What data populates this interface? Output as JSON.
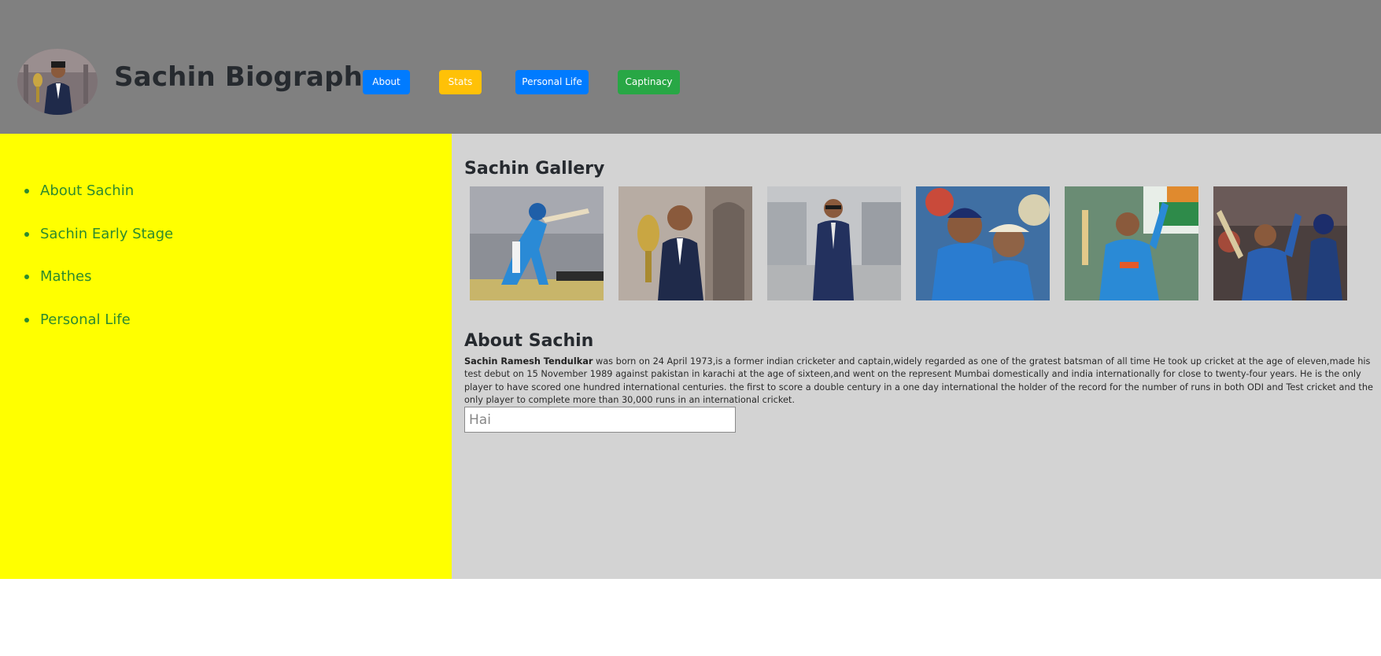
{
  "header": {
    "title": "Sachin Biography",
    "avatar": "sachin-avatar-photo",
    "buttons": {
      "about": "About",
      "stats": "Stats",
      "personal_life": "Personal Life",
      "captaincy": "Captinacy"
    }
  },
  "sidebar": {
    "items": [
      {
        "label": "About Sachin"
      },
      {
        "label": "Sachin Early Stage"
      },
      {
        "label": "Mathes"
      },
      {
        "label": "Personal Life"
      }
    ]
  },
  "main": {
    "gallery_title": "Sachin Gallery",
    "gallery": [
      {
        "name": "sachin-batting-photo"
      },
      {
        "name": "sachin-trophy-photo"
      },
      {
        "name": "sachin-suit-photo"
      },
      {
        "name": "sachin-with-teammate-photo"
      },
      {
        "name": "sachin-celebrating-photo"
      },
      {
        "name": "sachin-raising-bat-photo"
      }
    ],
    "about_title": "About Sachin",
    "about_name": "Sachin Ramesh Tendulkar",
    "about_body": " was born on 24 April 1973,is a former indian cricketer and captain,widely regarded as one of the gratest batsman of all time He took up cricket at the age of eleven,made his test debut on 15 November 1989 against pakistan in karachi at the age of sixteen,and went on the represent Mumbai domestically and india internationally for close to twenty-four years. He is the only player to have scored one hundred international centuries. the first to score a double century in a one day international the holder of the record for the number of runs in both ODI and Test cricket and the only player to complete more than 30,000 runs in an international cricket.",
    "input_value": "Hai"
  },
  "colors": {
    "header_bg": "#808080",
    "sidebar_bg": "#ffff00",
    "main_bg": "#d3d3d3",
    "primary": "#007bff",
    "warning": "#ffc107",
    "success": "#28a745",
    "sidebar_text": "#2e8b2e"
  }
}
